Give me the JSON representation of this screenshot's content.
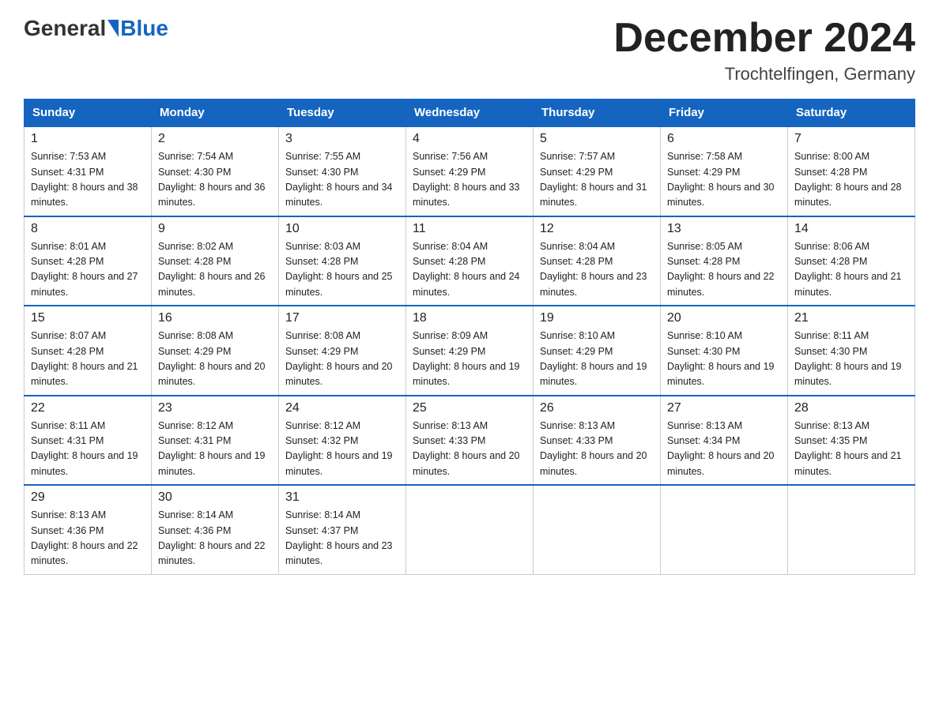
{
  "header": {
    "logo_general": "General",
    "logo_blue": "Blue",
    "month_title": "December 2024",
    "location": "Trochtelfingen, Germany"
  },
  "days_of_week": [
    "Sunday",
    "Monday",
    "Tuesday",
    "Wednesday",
    "Thursday",
    "Friday",
    "Saturday"
  ],
  "weeks": [
    [
      {
        "day": "1",
        "sunrise": "7:53 AM",
        "sunset": "4:31 PM",
        "daylight": "8 hours and 38 minutes."
      },
      {
        "day": "2",
        "sunrise": "7:54 AM",
        "sunset": "4:30 PM",
        "daylight": "8 hours and 36 minutes."
      },
      {
        "day": "3",
        "sunrise": "7:55 AM",
        "sunset": "4:30 PM",
        "daylight": "8 hours and 34 minutes."
      },
      {
        "day": "4",
        "sunrise": "7:56 AM",
        "sunset": "4:29 PM",
        "daylight": "8 hours and 33 minutes."
      },
      {
        "day": "5",
        "sunrise": "7:57 AM",
        "sunset": "4:29 PM",
        "daylight": "8 hours and 31 minutes."
      },
      {
        "day": "6",
        "sunrise": "7:58 AM",
        "sunset": "4:29 PM",
        "daylight": "8 hours and 30 minutes."
      },
      {
        "day": "7",
        "sunrise": "8:00 AM",
        "sunset": "4:28 PM",
        "daylight": "8 hours and 28 minutes."
      }
    ],
    [
      {
        "day": "8",
        "sunrise": "8:01 AM",
        "sunset": "4:28 PM",
        "daylight": "8 hours and 27 minutes."
      },
      {
        "day": "9",
        "sunrise": "8:02 AM",
        "sunset": "4:28 PM",
        "daylight": "8 hours and 26 minutes."
      },
      {
        "day": "10",
        "sunrise": "8:03 AM",
        "sunset": "4:28 PM",
        "daylight": "8 hours and 25 minutes."
      },
      {
        "day": "11",
        "sunrise": "8:04 AM",
        "sunset": "4:28 PM",
        "daylight": "8 hours and 24 minutes."
      },
      {
        "day": "12",
        "sunrise": "8:04 AM",
        "sunset": "4:28 PM",
        "daylight": "8 hours and 23 minutes."
      },
      {
        "day": "13",
        "sunrise": "8:05 AM",
        "sunset": "4:28 PM",
        "daylight": "8 hours and 22 minutes."
      },
      {
        "day": "14",
        "sunrise": "8:06 AM",
        "sunset": "4:28 PM",
        "daylight": "8 hours and 21 minutes."
      }
    ],
    [
      {
        "day": "15",
        "sunrise": "8:07 AM",
        "sunset": "4:28 PM",
        "daylight": "8 hours and 21 minutes."
      },
      {
        "day": "16",
        "sunrise": "8:08 AM",
        "sunset": "4:29 PM",
        "daylight": "8 hours and 20 minutes."
      },
      {
        "day": "17",
        "sunrise": "8:08 AM",
        "sunset": "4:29 PM",
        "daylight": "8 hours and 20 minutes."
      },
      {
        "day": "18",
        "sunrise": "8:09 AM",
        "sunset": "4:29 PM",
        "daylight": "8 hours and 19 minutes."
      },
      {
        "day": "19",
        "sunrise": "8:10 AM",
        "sunset": "4:29 PM",
        "daylight": "8 hours and 19 minutes."
      },
      {
        "day": "20",
        "sunrise": "8:10 AM",
        "sunset": "4:30 PM",
        "daylight": "8 hours and 19 minutes."
      },
      {
        "day": "21",
        "sunrise": "8:11 AM",
        "sunset": "4:30 PM",
        "daylight": "8 hours and 19 minutes."
      }
    ],
    [
      {
        "day": "22",
        "sunrise": "8:11 AM",
        "sunset": "4:31 PM",
        "daylight": "8 hours and 19 minutes."
      },
      {
        "day": "23",
        "sunrise": "8:12 AM",
        "sunset": "4:31 PM",
        "daylight": "8 hours and 19 minutes."
      },
      {
        "day": "24",
        "sunrise": "8:12 AM",
        "sunset": "4:32 PM",
        "daylight": "8 hours and 19 minutes."
      },
      {
        "day": "25",
        "sunrise": "8:13 AM",
        "sunset": "4:33 PM",
        "daylight": "8 hours and 20 minutes."
      },
      {
        "day": "26",
        "sunrise": "8:13 AM",
        "sunset": "4:33 PM",
        "daylight": "8 hours and 20 minutes."
      },
      {
        "day": "27",
        "sunrise": "8:13 AM",
        "sunset": "4:34 PM",
        "daylight": "8 hours and 20 minutes."
      },
      {
        "day": "28",
        "sunrise": "8:13 AM",
        "sunset": "4:35 PM",
        "daylight": "8 hours and 21 minutes."
      }
    ],
    [
      {
        "day": "29",
        "sunrise": "8:13 AM",
        "sunset": "4:36 PM",
        "daylight": "8 hours and 22 minutes."
      },
      {
        "day": "30",
        "sunrise": "8:14 AM",
        "sunset": "4:36 PM",
        "daylight": "8 hours and 22 minutes."
      },
      {
        "day": "31",
        "sunrise": "8:14 AM",
        "sunset": "4:37 PM",
        "daylight": "8 hours and 23 minutes."
      },
      null,
      null,
      null,
      null
    ]
  ]
}
